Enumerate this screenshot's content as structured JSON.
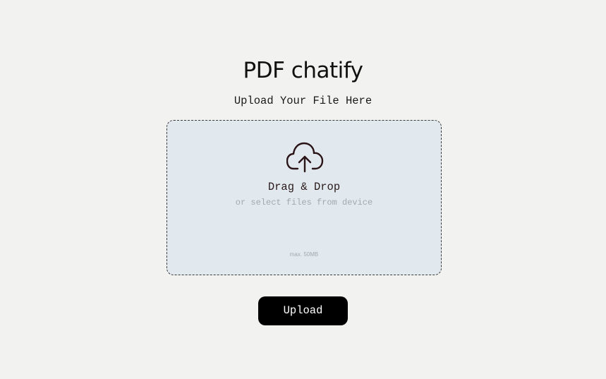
{
  "app": {
    "title": "PDF chatify"
  },
  "upload": {
    "heading": "Upload Your File Here",
    "dropzone": {
      "icon": "cloud-upload-icon",
      "title": "Drag & Drop",
      "subtitle": "or select files from device",
      "max_size": "max. 50MB"
    },
    "button_label": "Upload"
  },
  "colors": {
    "background": "#f2f2f1",
    "dropzone_fill": "#e2e9ee",
    "icon": "#2a1418",
    "button": "#000000",
    "button_text": "#ffffff"
  }
}
